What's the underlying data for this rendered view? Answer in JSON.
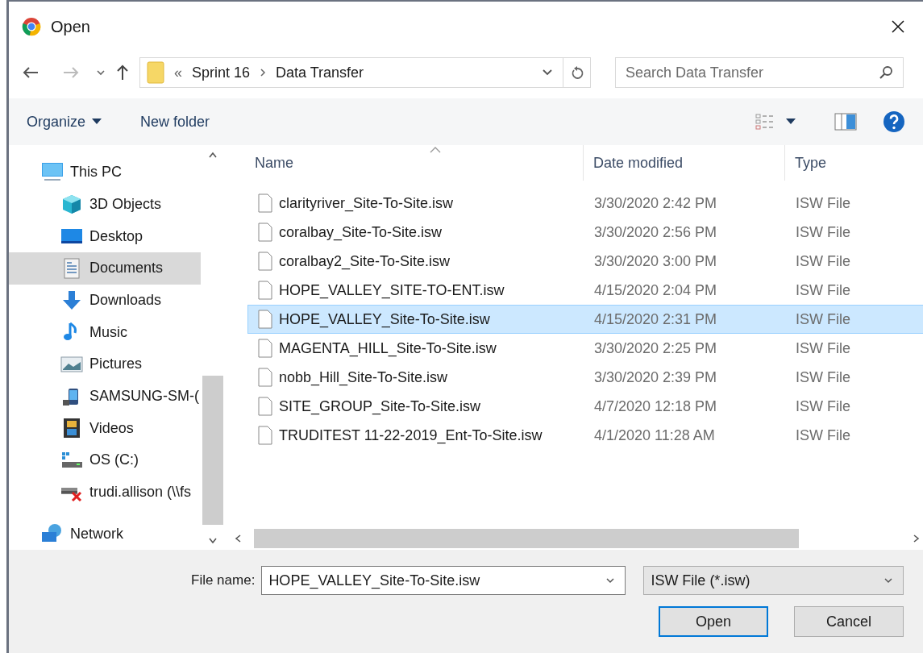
{
  "window": {
    "title": "Open"
  },
  "address": {
    "crumbs": [
      "«",
      "Sprint 16",
      "Data Transfer"
    ]
  },
  "search": {
    "placeholder": "Search Data Transfer"
  },
  "toolbar": {
    "organize": "Organize",
    "new_folder": "New folder"
  },
  "sidebar": {
    "items": [
      {
        "label": "This PC",
        "kind": "pc",
        "selected": false,
        "children": [
          {
            "label": "3D Objects",
            "kind": "cube",
            "selected": false
          },
          {
            "label": "Desktop",
            "kind": "desktop",
            "selected": false
          },
          {
            "label": "Documents",
            "kind": "documents",
            "selected": true
          },
          {
            "label": "Downloads",
            "kind": "downloads",
            "selected": false
          },
          {
            "label": "Music",
            "kind": "music",
            "selected": false
          },
          {
            "label": "Pictures",
            "kind": "pictures",
            "selected": false
          },
          {
            "label": "SAMSUNG-SM-(",
            "kind": "phone",
            "selected": false
          },
          {
            "label": "Videos",
            "kind": "videos",
            "selected": false
          },
          {
            "label": "OS (C:)",
            "kind": "drive",
            "selected": false
          },
          {
            "label": "trudi.allison (\\\\fs",
            "kind": "netdrive",
            "selected": false
          }
        ]
      },
      {
        "label": "Network",
        "kind": "network",
        "selected": false
      }
    ]
  },
  "table": {
    "columns": [
      "Name",
      "Date modified",
      "Type"
    ],
    "rows": [
      {
        "name": "clarityriver_Site-To-Site.isw",
        "date": "3/30/2020 2:42 PM",
        "type": "ISW File",
        "selected": false
      },
      {
        "name": "coralbay_Site-To-Site.isw",
        "date": "3/30/2020 2:56 PM",
        "type": "ISW File",
        "selected": false
      },
      {
        "name": "coralbay2_Site-To-Site.isw",
        "date": "3/30/2020 3:00 PM",
        "type": "ISW File",
        "selected": false
      },
      {
        "name": "HOPE_VALLEY_SITE-TO-ENT.isw",
        "date": "4/15/2020 2:04 PM",
        "type": "ISW File",
        "selected": false
      },
      {
        "name": "HOPE_VALLEY_Site-To-Site.isw",
        "date": "4/15/2020 2:31 PM",
        "type": "ISW File",
        "selected": true
      },
      {
        "name": "MAGENTA_HILL_Site-To-Site.isw",
        "date": "3/30/2020 2:25 PM",
        "type": "ISW File",
        "selected": false
      },
      {
        "name": "nobb_Hill_Site-To-Site.isw",
        "date": "3/30/2020 2:39 PM",
        "type": "ISW File",
        "selected": false
      },
      {
        "name": "SITE_GROUP_Site-To-Site.isw",
        "date": "4/7/2020 12:18 PM",
        "type": "ISW File",
        "selected": false
      },
      {
        "name": "TRUDITEST 11-22-2019_Ent-To-Site.isw",
        "date": "4/1/2020 11:28 AM",
        "type": "ISW File",
        "selected": false
      }
    ]
  },
  "footer": {
    "file_name_label": "File name:",
    "file_name": "HOPE_VALLEY_Site-To-Site.isw",
    "file_type": "ISW File (*.isw)",
    "buttons": [
      "Open",
      "Cancel"
    ]
  }
}
